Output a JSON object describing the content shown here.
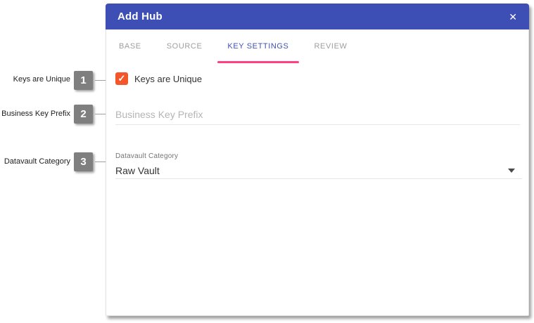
{
  "dialog": {
    "title": "Add Hub",
    "close_icon": "✕",
    "tabs": [
      {
        "label": "BASE",
        "active": false
      },
      {
        "label": "SOURCE",
        "active": false
      },
      {
        "label": "KEY SETTINGS",
        "active": true
      },
      {
        "label": "REVIEW",
        "active": false
      }
    ],
    "form": {
      "checkbox": {
        "label": "Keys are Unique",
        "checked": true,
        "check_glyph": "✓"
      },
      "text_input": {
        "placeholder": "Business Key Prefix",
        "value": ""
      },
      "select": {
        "label": "Datavault Category",
        "value": "Raw Vault"
      }
    }
  },
  "annotations": [
    {
      "number": "1",
      "label": "Keys are Unique"
    },
    {
      "number": "2",
      "label": "Business Key Prefix"
    },
    {
      "number": "3",
      "label": "Datavault Category"
    }
  ],
  "colors": {
    "header-bg": "#3d4eb5",
    "active-tab": "#3f51b5",
    "inactive-tab": "#9e9e9e",
    "tab-underline": "#ff4081",
    "checkbox-bg": "#f4562c",
    "badge-bg": "#7f7f7f"
  }
}
